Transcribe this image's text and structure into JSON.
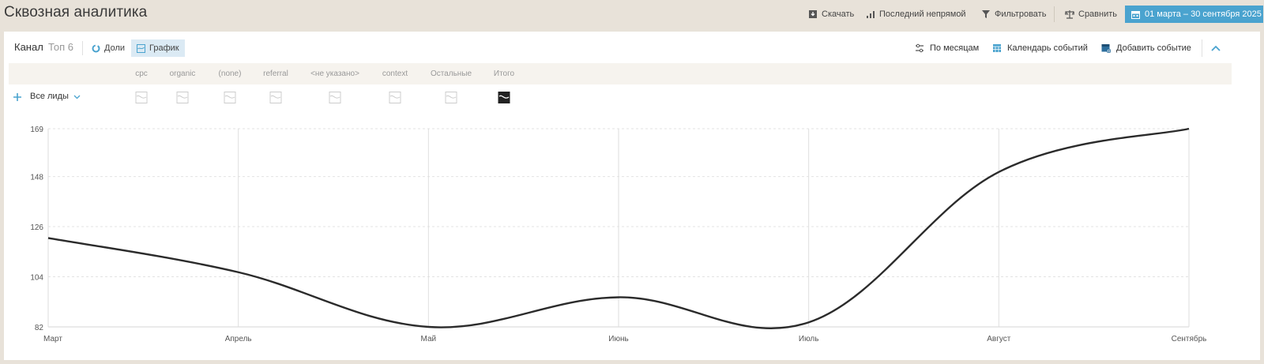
{
  "page": {
    "title": "Сквозная аналитика"
  },
  "header": {
    "download": "Скачать",
    "attribution": "Последний непрямой",
    "filter": "Фильтровать",
    "compare": "Сравнить",
    "date_range": "01 марта – 30 сентября 2025"
  },
  "toolbar": {
    "dimension": "Канал",
    "top": "Топ 6",
    "shares": "Доли",
    "graph": "График",
    "by_months": "По месяцам",
    "events_calendar": "Календарь событий",
    "add_event": "Добавить событие"
  },
  "series_header": [
    "cpc",
    "organic",
    "(none)",
    "referral",
    "<не указано>",
    "context",
    "Остальные",
    "Итого"
  ],
  "metric": {
    "label": "Все лиды"
  },
  "colors": {
    "accent": "#4aa3cf",
    "line": "#2b2b2b",
    "active_tab": "#dbeaf4"
  },
  "chart_data": {
    "type": "line",
    "categories": [
      "Март",
      "Апрель",
      "Май",
      "Июнь",
      "Июль",
      "Август",
      "Сентябрь"
    ],
    "series": [
      {
        "name": "Итого",
        "values": [
          121,
          106,
          82,
          95,
          84,
          150,
          169
        ]
      }
    ],
    "yticks": [
      82,
      104,
      126,
      148,
      169
    ],
    "ylim": [
      82,
      169
    ],
    "grid": true
  }
}
